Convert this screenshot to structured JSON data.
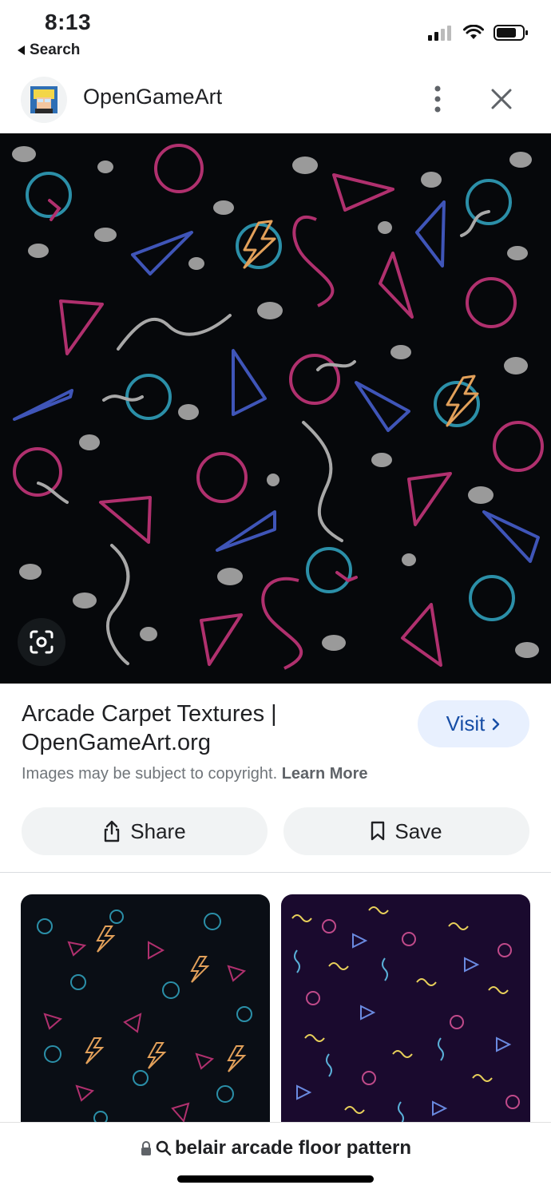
{
  "status_bar": {
    "time": "8:13",
    "back_label": "Search"
  },
  "header": {
    "site_name": "OpenGameArt",
    "more_icon": "vertical-dots-icon",
    "close_icon": "close-icon"
  },
  "result": {
    "title": "Arcade Carpet Textures | OpenGameArt.org",
    "visit_label": "Visit",
    "copyright_text": "Images may be subject to copyright.",
    "learn_more": "Learn More"
  },
  "actions": {
    "share_label": "Share",
    "save_label": "Save"
  },
  "search": {
    "query": "belair arcade floor pattern"
  },
  "colors": {
    "visit_bg": "#e8f0fe",
    "visit_text": "#174ea6",
    "pill_bg": "#f1f3f4",
    "hero_bg": "#06080b"
  }
}
